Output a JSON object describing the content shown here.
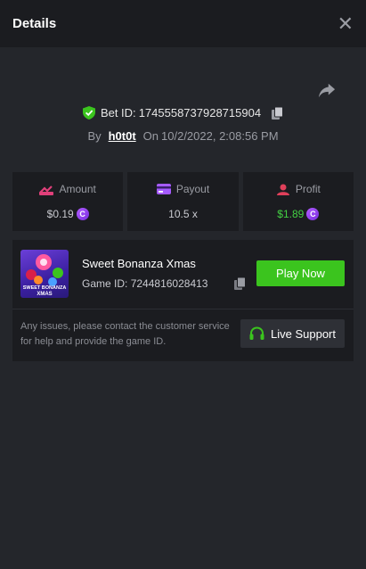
{
  "header": {
    "title": "Details"
  },
  "bet": {
    "bet_id_label": "Bet ID:",
    "bet_id": "1745558737928715904",
    "by_label": "By",
    "user": "h0t0t",
    "on_label": "On",
    "datetime": "10/2/2022, 2:08:56 PM"
  },
  "stats": {
    "amount_label": "Amount",
    "amount_value": "$0.19",
    "payout_label": "Payout",
    "payout_value": "10.5 x",
    "profit_label": "Profit",
    "profit_value": "$1.89",
    "coin_symbol": "C"
  },
  "game": {
    "name": "Sweet Bonanza Xmas",
    "id_label": "Game ID:",
    "id": "7244816028413",
    "play_label": "Play Now",
    "thumb_text_1": "SWEET BONANZA",
    "thumb_text_2": "XMAS"
  },
  "support": {
    "text": "Any issues, please contact the customer service for help and provide the game ID.",
    "button_label": "Live Support"
  },
  "colors": {
    "background": "#24262b",
    "panel": "#1b1c20",
    "accent_green": "#3bc41e",
    "profit_green": "#43d043",
    "coin_purple": "#9b4dff",
    "amount_pink": "#e0407a",
    "payout_purple": "#a65bff",
    "profit_red": "#e0405a"
  },
  "icons": [
    "close-icon",
    "share-icon",
    "shield-check-icon",
    "copy-icon",
    "amount-icon",
    "payout-icon",
    "profit-icon",
    "coin-icon",
    "headset-icon"
  ]
}
